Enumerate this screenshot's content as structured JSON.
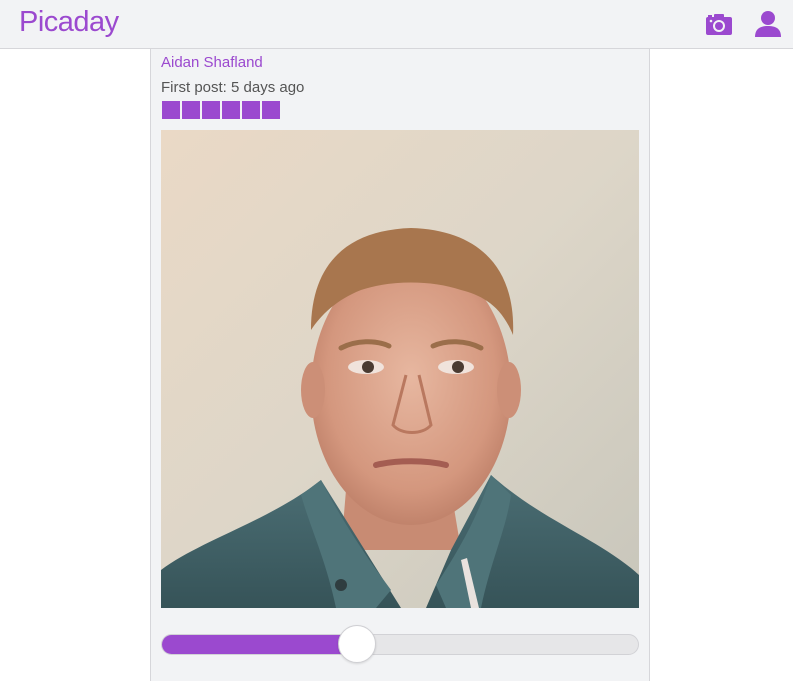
{
  "app": {
    "name": "Picaday"
  },
  "header": {
    "icons": [
      "camera-icon",
      "user-icon"
    ]
  },
  "post": {
    "author": "Aidan Shafland",
    "first_post": "First post: 5 days ago",
    "streak_count": 6,
    "photo_description_icon": "photo",
    "slider_value": 0.41
  },
  "colors": {
    "accent": "#9b49cf",
    "background": "#f2f3f5",
    "border": "#d6d6da",
    "muted_text": "#555555"
  }
}
